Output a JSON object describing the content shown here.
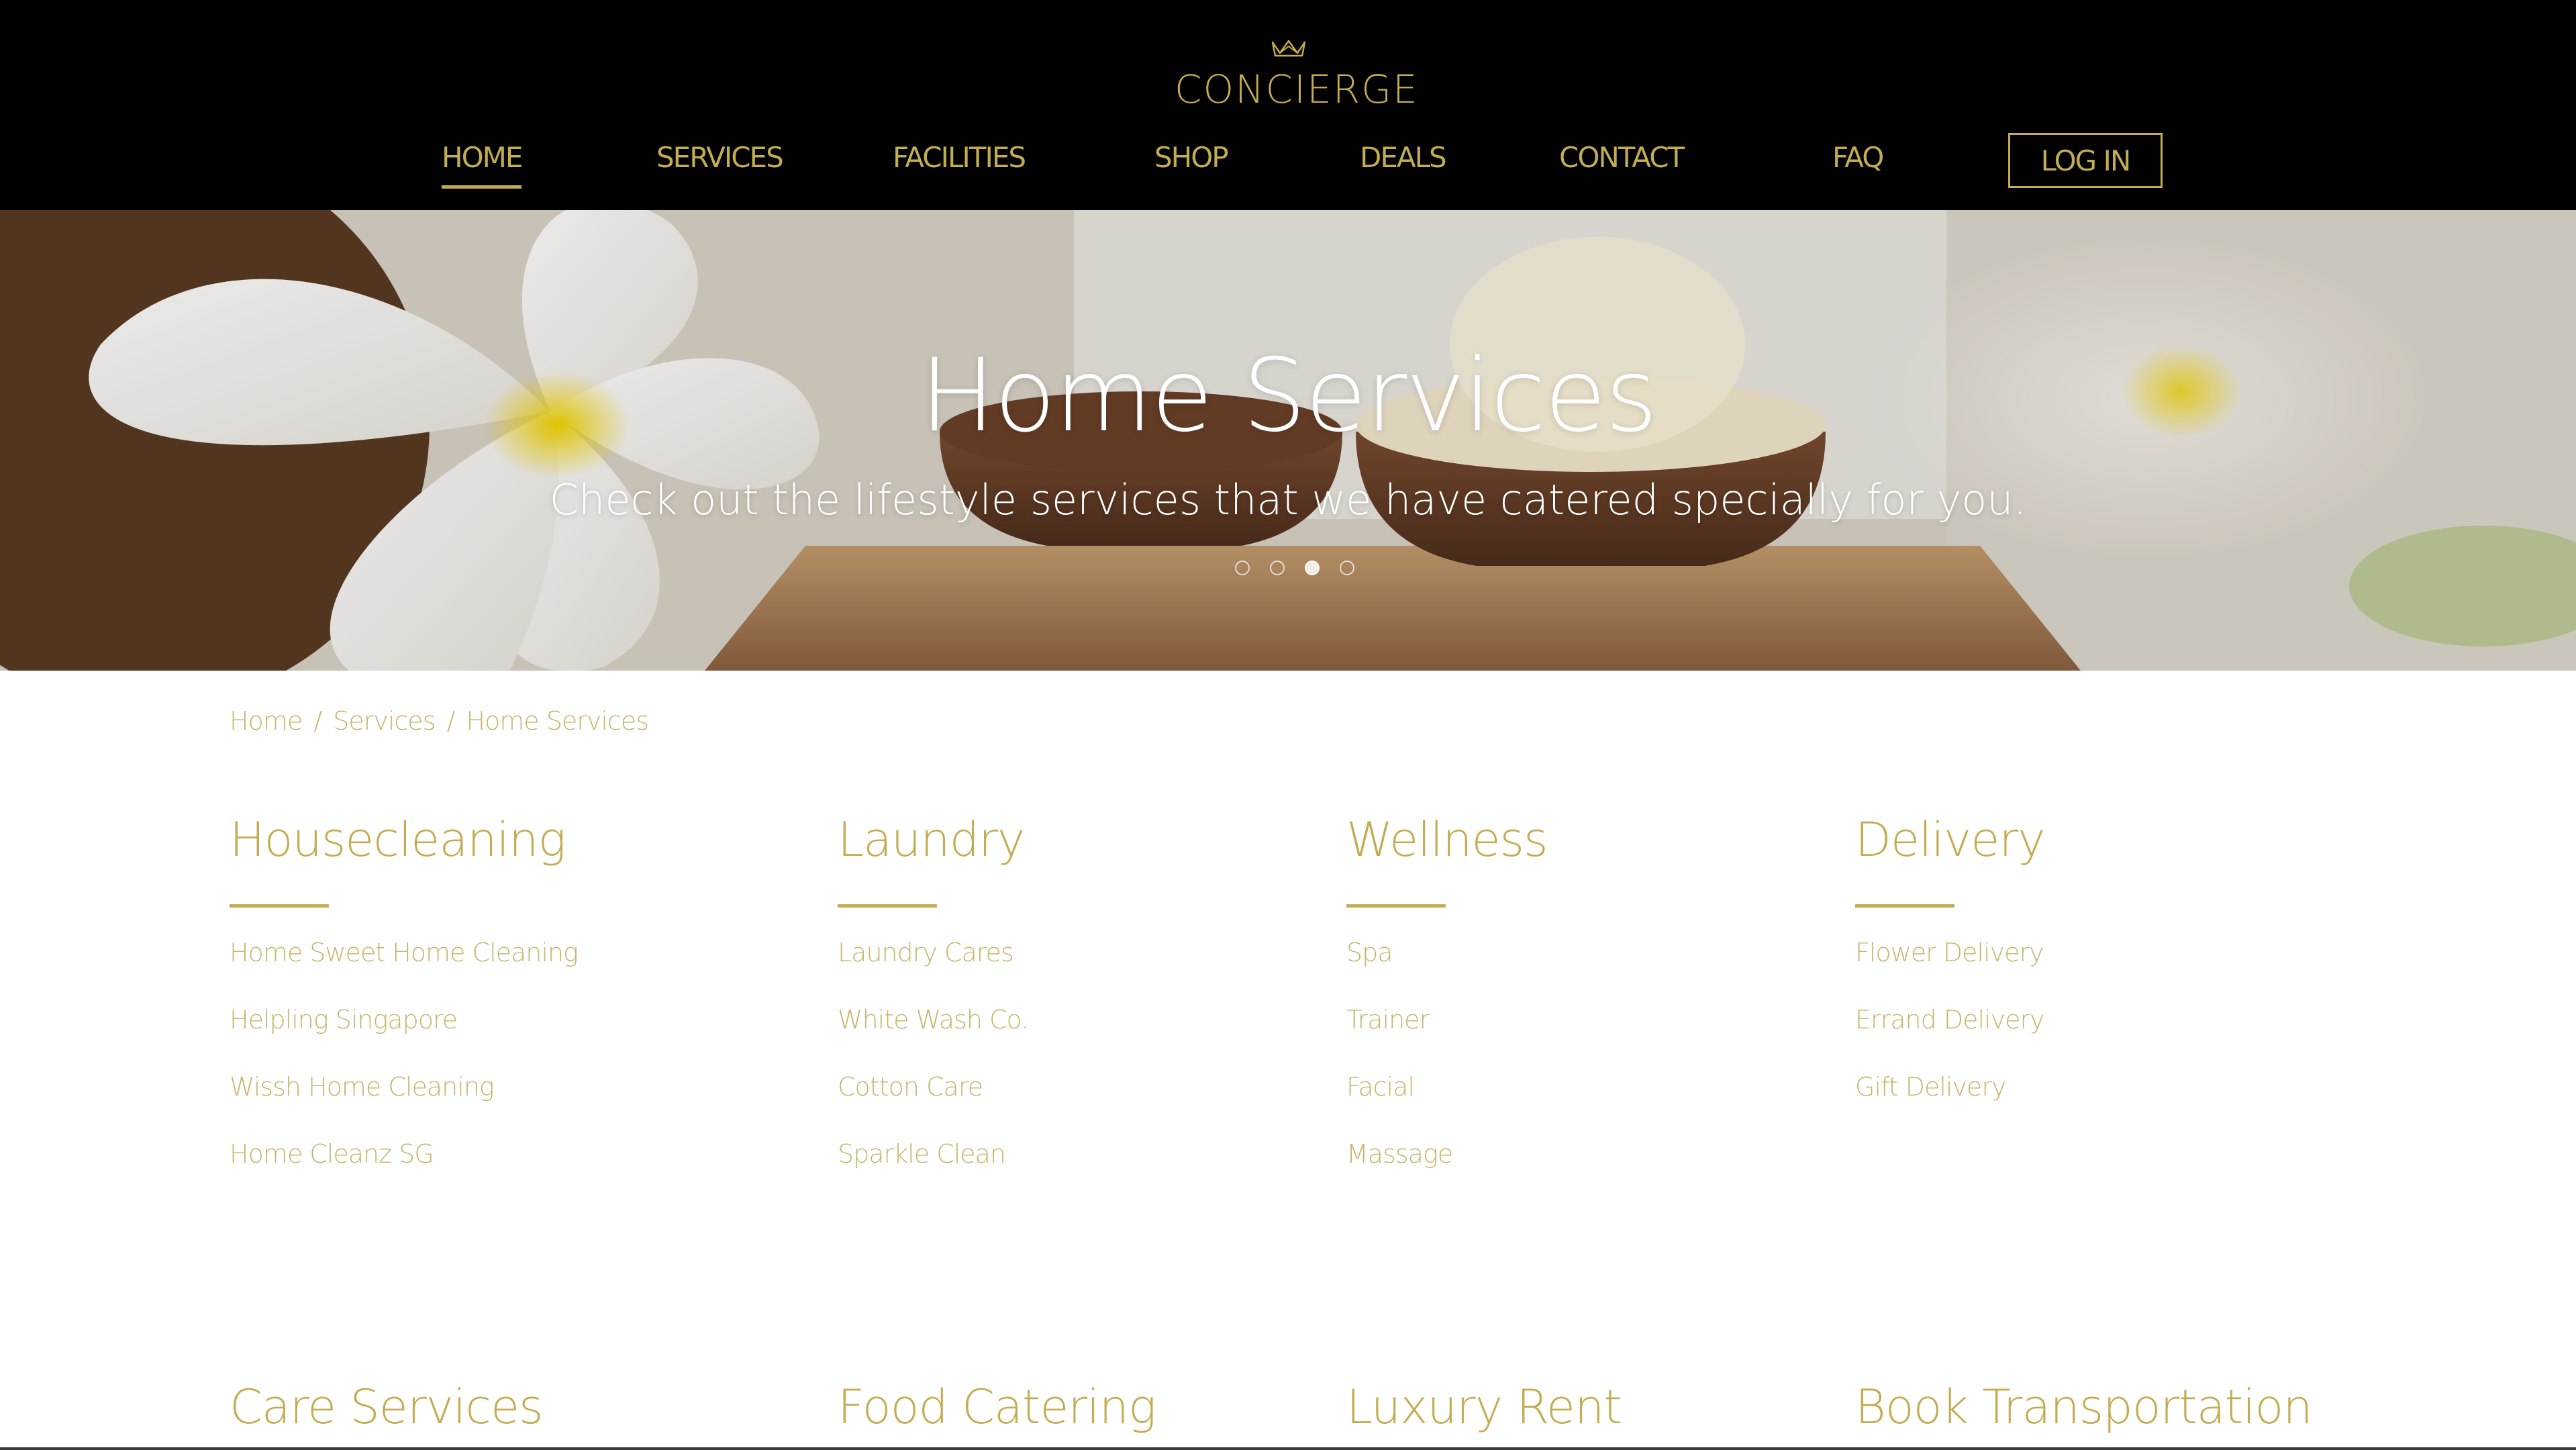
{
  "brand": {
    "name": "CONCIERGE",
    "color": "#c3ad52"
  },
  "nav": {
    "items": [
      {
        "label": "HOME",
        "active": true
      },
      {
        "label": "SERVICES"
      },
      {
        "label": "FACILITIES"
      },
      {
        "label": "SHOP"
      },
      {
        "label": "DEALS"
      },
      {
        "label": "CONTACT"
      },
      {
        "label": "FAQ"
      }
    ],
    "login_label": "LOG IN"
  },
  "hero": {
    "title": "Home Services",
    "subtitle": "Check out the lifestyle services that we have catered specially for you.",
    "slides": 4,
    "active_slide": 3
  },
  "breadcrumb": {
    "items": [
      "Home",
      "Services",
      "Home Services"
    ],
    "separator": "/"
  },
  "categories": [
    {
      "title": "Housecleaning",
      "items": [
        "Home Sweet Home Cleaning",
        "Helpling Singapore",
        "Wissh Home Cleaning",
        "Home Cleanz SG"
      ]
    },
    {
      "title": "Laundry",
      "items": [
        "Laundry Cares",
        "White Wash Co.",
        "Cotton Care",
        "Sparkle Clean"
      ]
    },
    {
      "title": "Wellness",
      "items": [
        "Spa",
        "Trainer",
        "Facial",
        "Massage"
      ]
    },
    {
      "title": "Delivery",
      "items": [
        "Flower Delivery",
        "Errand Delivery",
        "Gift Delivery"
      ]
    },
    {
      "title": "Care Services",
      "items": []
    },
    {
      "title": "Food Catering",
      "items": []
    },
    {
      "title": "Luxury Rent",
      "items": []
    },
    {
      "title": "Book Transportation",
      "items": []
    }
  ],
  "icons": {
    "logo": "crown-icon"
  }
}
